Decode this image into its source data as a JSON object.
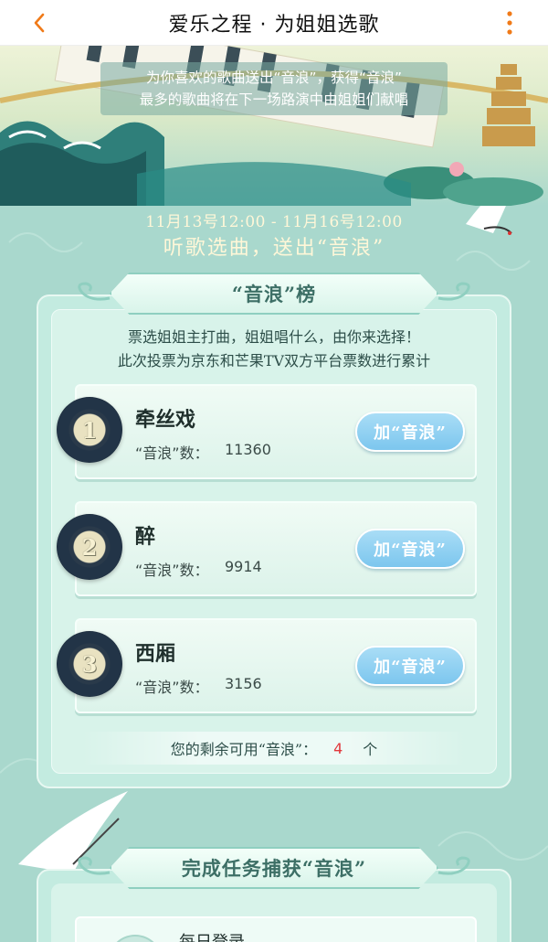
{
  "nav": {
    "title": "爱乐之程 · 为姐姐选歌"
  },
  "banner": {
    "line1": "为你喜欢的歌曲送出“音浪”，获得“音浪”",
    "line2": "最多的歌曲将在下一场路演中由姐姐们献唱"
  },
  "event": {
    "date_range": "11月13号12:00 - 11月16号12:00",
    "slogan": "听歌选曲，送出“音浪”"
  },
  "ranking": {
    "title": "“音浪”榜",
    "desc_line1": "票选姐姐主打曲，姐姐唱什么，由你来选择！",
    "desc_line2": "此次投票为京东和芒果TV双方平台票数进行累计",
    "count_label": "“音浪”数：",
    "vote_label": "加“音浪”",
    "songs": [
      {
        "rank": "1",
        "name": "牵丝戏",
        "count": "11360"
      },
      {
        "rank": "2",
        "name": "醉",
        "count": "9914"
      },
      {
        "rank": "3",
        "name": "西厢",
        "count": "3156"
      }
    ],
    "remaining_prefix": "您的剩余可用“音浪”：",
    "remaining_value": "4",
    "remaining_unit": "个"
  },
  "tasks": {
    "title": "完成任务捕获“音浪”",
    "first_task_partial": "每日登录"
  },
  "colors": {
    "background": "#a9d8cd",
    "panel": "#c3ebe0",
    "vote_button": "#7cc6ee",
    "highlight_number": "#e1383c"
  },
  "icons": {
    "back": "chevron-left-icon",
    "more": "more-vertical-icon",
    "disc": "vinyl-record-icon"
  }
}
